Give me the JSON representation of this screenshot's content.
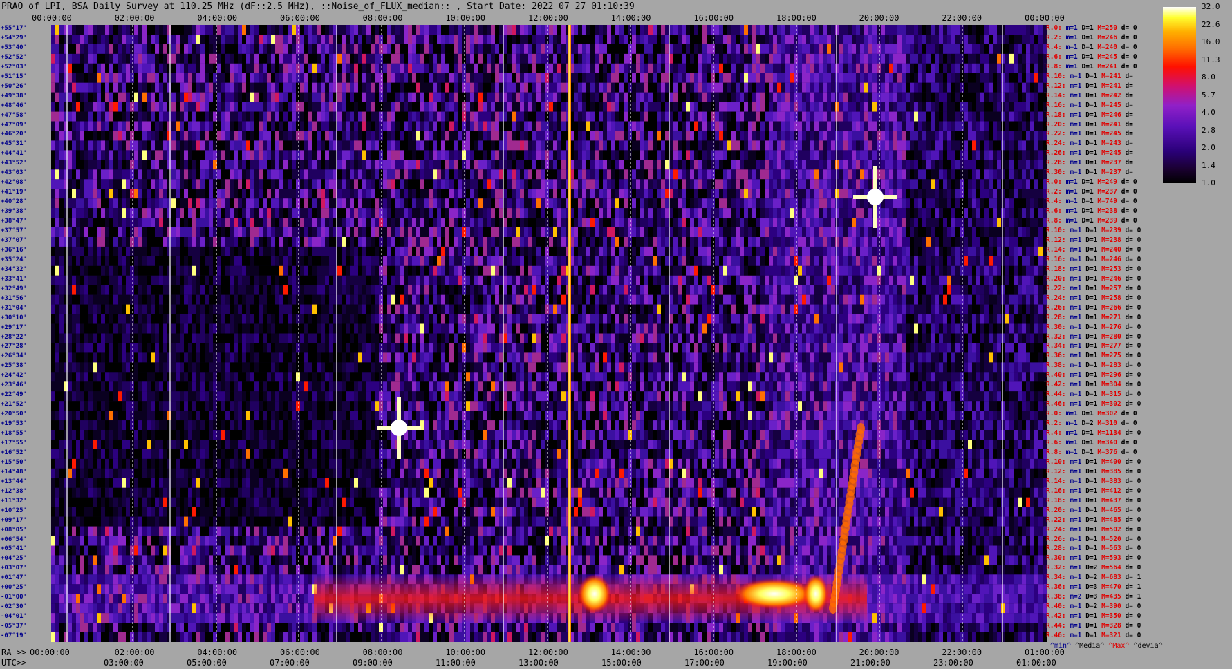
{
  "title": "PRAO of LPI, BSA Daily Survey at 110.25 MHz (dF::2.5 MHz), ::Noise_of_FLUX_median:: , Start Date: 2022 07 27 01:10:39",
  "chart_data": {
    "type": "heatmap",
    "top_axis_labels": [
      "00:00:00",
      "02:00:00",
      "04:00:00",
      "06:00:00",
      "08:00:00",
      "10:00:00",
      "12:00:00",
      "14:00:00",
      "16:00:00",
      "18:00:00",
      "20:00:00",
      "22:00:00",
      "00:00:00"
    ],
    "ra_axis_prefix": "RA >>",
    "ra_axis_labels": [
      "00:00:00",
      "02:00:00",
      "04:00:00",
      "06:00:00",
      "08:00:00",
      "10:00:00",
      "12:00:00",
      "14:00:00",
      "16:00:00",
      "18:00:00",
      "20:00:00",
      "22:00:00",
      "01:00:00"
    ],
    "utc_axis_prefix": "UTC>>",
    "utc_axis_labels": [
      "03:00:00",
      "05:00:00",
      "07:00:00",
      "09:00:00",
      "11:00:00",
      "13:00:00",
      "15:00:00",
      "17:00:00",
      "19:00:00",
      "21:00:00",
      "23:00:00",
      "01:00:00"
    ],
    "declinations": [
      "+55°17'",
      "+54°29'",
      "+53°40'",
      "+52°52'",
      "+52°03'",
      "+51°15'",
      "+50°26'",
      "+49°38'",
      "+48°46'",
      "+47°58'",
      "+47°09'",
      "+46°20'",
      "+45°31'",
      "+44°41'",
      "+43°52'",
      "+43°03'",
      "+42°08'",
      "+41°19'",
      "+40°28'",
      "+39°38'",
      "+38°47'",
      "+37°57'",
      "+37°07'",
      "+36°16'",
      "+35°24'",
      "+34°32'",
      "+33°41'",
      "+32°49'",
      "+31°56'",
      "+31°04'",
      "+30°10'",
      "+29°17'",
      "+28°22'",
      "+27°28'",
      "+26°34'",
      "+25°38'",
      "+24°42'",
      "+23°46'",
      "+22°49'",
      "+21°52'",
      "+20°50'",
      "+19°53'",
      "+18°55'",
      "+17°55'",
      "+16°52'",
      "+15°50'",
      "+14°48'",
      "+13°44'",
      "+12°38'",
      "+11°32'",
      "+10°25'",
      "+09°17'",
      "+08°05'",
      "+06°54'",
      "+05°41'",
      "+04°25'",
      "+03°07'",
      "+01°47'",
      "+00°25'",
      "-01°00'",
      "-02°30'",
      "-04°01'",
      "-05°37'",
      "-07°19'"
    ],
    "row_stats": [
      {
        "r": "R.0:",
        "m": "m=1",
        "d": "D=1",
        "mx": "M=250",
        "dv": "d= 0"
      },
      {
        "r": "R.2:",
        "m": "m=1",
        "d": "D=1",
        "mx": "M=246",
        "dv": "d= 0"
      },
      {
        "r": "R.4:",
        "m": "m=1",
        "d": "D=1",
        "mx": "M=240",
        "dv": "d= 0"
      },
      {
        "r": "R.6:",
        "m": "m=1",
        "d": "D=1",
        "mx": "M=245",
        "dv": "d= 0"
      },
      {
        "r": "R.8:",
        "m": "m=1",
        "d": "D=1",
        "mx": "M=241",
        "dv": "d= 0"
      },
      {
        "r": "R.10:",
        "m": "m=1",
        "d": "D=1",
        "mx": "M=241",
        "dv": "d="
      },
      {
        "r": "R.12:",
        "m": "m=1",
        "d": "D=1",
        "mx": "M=241",
        "dv": "d="
      },
      {
        "r": "R.14:",
        "m": "m=1",
        "d": "D=1",
        "mx": "M=242",
        "dv": "d="
      },
      {
        "r": "R.16:",
        "m": "m=1",
        "d": "D=1",
        "mx": "M=245",
        "dv": "d="
      },
      {
        "r": "R.18:",
        "m": "m=1",
        "d": "D=1",
        "mx": "M=246",
        "dv": "d="
      },
      {
        "r": "R.20:",
        "m": "m=1",
        "d": "D=1",
        "mx": "M=241",
        "dv": "d="
      },
      {
        "r": "R.22:",
        "m": "m=1",
        "d": "D=1",
        "mx": "M=245",
        "dv": "d="
      },
      {
        "r": "R.24:",
        "m": "m=1",
        "d": "D=1",
        "mx": "M=243",
        "dv": "d="
      },
      {
        "r": "R.26:",
        "m": "m=1",
        "d": "D=1",
        "mx": "M=245",
        "dv": "d="
      },
      {
        "r": "R.28:",
        "m": "m=1",
        "d": "D=1",
        "mx": "M=237",
        "dv": "d="
      },
      {
        "r": "R.30:",
        "m": "m=1",
        "d": "D=1",
        "mx": "M=237",
        "dv": "d="
      },
      {
        "r": "R.0:",
        "m": "m=1",
        "d": "D=1",
        "mx": "M=249",
        "dv": "d= 0"
      },
      {
        "r": "R.2:",
        "m": "m=1",
        "d": "D=1",
        "mx": "M=237",
        "dv": "d= 0"
      },
      {
        "r": "R.4:",
        "m": "m=1",
        "d": "D=1",
        "mx": "M=749",
        "dv": "d= 0"
      },
      {
        "r": "R.6:",
        "m": "m=1",
        "d": "D=1",
        "mx": "M=238",
        "dv": "d= 0"
      },
      {
        "r": "R.8:",
        "m": "m=1",
        "d": "D=1",
        "mx": "M=239",
        "dv": "d= 0"
      },
      {
        "r": "R.10:",
        "m": "m=1",
        "d": "D=1",
        "mx": "M=239",
        "dv": "d= 0"
      },
      {
        "r": "R.12:",
        "m": "m=1",
        "d": "D=1",
        "mx": "M=238",
        "dv": "d= 0"
      },
      {
        "r": "R.14:",
        "m": "m=1",
        "d": "D=1",
        "mx": "M=240",
        "dv": "d= 0"
      },
      {
        "r": "R.16:",
        "m": "m=1",
        "d": "D=1",
        "mx": "M=246",
        "dv": "d= 0"
      },
      {
        "r": "R.18:",
        "m": "m=1",
        "d": "D=1",
        "mx": "M=253",
        "dv": "d= 0"
      },
      {
        "r": "R.20:",
        "m": "m=1",
        "d": "D=1",
        "mx": "M=246",
        "dv": "d= 0"
      },
      {
        "r": "R.22:",
        "m": "m=1",
        "d": "D=1",
        "mx": "M=257",
        "dv": "d= 0"
      },
      {
        "r": "R.24:",
        "m": "m=1",
        "d": "D=1",
        "mx": "M=258",
        "dv": "d= 0"
      },
      {
        "r": "R.26:",
        "m": "m=1",
        "d": "D=1",
        "mx": "M=266",
        "dv": "d= 0"
      },
      {
        "r": "R.28:",
        "m": "m=1",
        "d": "D=1",
        "mx": "M=271",
        "dv": "d= 0"
      },
      {
        "r": "R.30:",
        "m": "m=1",
        "d": "D=1",
        "mx": "M=276",
        "dv": "d= 0"
      },
      {
        "r": "R.32:",
        "m": "m=1",
        "d": "D=1",
        "mx": "M=280",
        "dv": "d= 0"
      },
      {
        "r": "R.34:",
        "m": "m=1",
        "d": "D=1",
        "mx": "M=277",
        "dv": "d= 0"
      },
      {
        "r": "R.36:",
        "m": "m=1",
        "d": "D=1",
        "mx": "M=275",
        "dv": "d= 0"
      },
      {
        "r": "R.38:",
        "m": "m=1",
        "d": "D=1",
        "mx": "M=283",
        "dv": "d= 0"
      },
      {
        "r": "R.40:",
        "m": "m=1",
        "d": "D=1",
        "mx": "M=296",
        "dv": "d= 0"
      },
      {
        "r": "R.42:",
        "m": "m=1",
        "d": "D=1",
        "mx": "M=304",
        "dv": "d= 0"
      },
      {
        "r": "R.44:",
        "m": "m=1",
        "d": "D=1",
        "mx": "M=315",
        "dv": "d= 0"
      },
      {
        "r": "R.46:",
        "m": "m=1",
        "d": "D=1",
        "mx": "M=302",
        "dv": "d= 0"
      },
      {
        "r": "R.0:",
        "m": "m=1",
        "d": "D=1",
        "mx": "M=302",
        "dv": "d= 0"
      },
      {
        "r": "R.2:",
        "m": "m=1",
        "d": "D=2",
        "mx": "M=310",
        "dv": "d= 0"
      },
      {
        "r": "R.4:",
        "m": "m=1",
        "d": "D=1",
        "mx": "M=1134",
        "dv": "d= 0"
      },
      {
        "r": "R.6:",
        "m": "m=1",
        "d": "D=1",
        "mx": "M=340",
        "dv": "d= 0"
      },
      {
        "r": "R.8:",
        "m": "m=1",
        "d": "D=1",
        "mx": "M=376",
        "dv": "d= 0"
      },
      {
        "r": "R.10:",
        "m": "m=1",
        "d": "D=1",
        "mx": "M=400",
        "dv": "d= 0"
      },
      {
        "r": "R.12:",
        "m": "m=1",
        "d": "D=1",
        "mx": "M=385",
        "dv": "d= 0"
      },
      {
        "r": "R.14:",
        "m": "m=1",
        "d": "D=1",
        "mx": "M=383",
        "dv": "d= 0"
      },
      {
        "r": "R.16:",
        "m": "m=1",
        "d": "D=1",
        "mx": "M=412",
        "dv": "d= 0"
      },
      {
        "r": "R.18:",
        "m": "m=1",
        "d": "D=1",
        "mx": "M=437",
        "dv": "d= 0"
      },
      {
        "r": "R.20:",
        "m": "m=1",
        "d": "D=1",
        "mx": "M=465",
        "dv": "d= 0"
      },
      {
        "r": "R.22:",
        "m": "m=1",
        "d": "D=1",
        "mx": "M=485",
        "dv": "d= 0"
      },
      {
        "r": "R.24:",
        "m": "m=1",
        "d": "D=1",
        "mx": "M=502",
        "dv": "d= 0"
      },
      {
        "r": "R.26:",
        "m": "m=1",
        "d": "D=1",
        "mx": "M=520",
        "dv": "d= 0"
      },
      {
        "r": "R.28:",
        "m": "m=1",
        "d": "D=1",
        "mx": "M=563",
        "dv": "d= 0"
      },
      {
        "r": "R.30:",
        "m": "m=1",
        "d": "D=1",
        "mx": "M=593",
        "dv": "d= 0"
      },
      {
        "r": "R.32:",
        "m": "m=1",
        "d": "D=2",
        "mx": "M=564",
        "dv": "d= 0"
      },
      {
        "r": "R.34:",
        "m": "m=1",
        "d": "D=2",
        "mx": "M=683",
        "dv": "d= 1"
      },
      {
        "r": "R.36:",
        "m": "m=1",
        "d": "D=3",
        "mx": "M=470",
        "dv": "d= 1"
      },
      {
        "r": "R.38:",
        "m": "m=2",
        "d": "D=3",
        "mx": "M=435",
        "dv": "d= 1"
      },
      {
        "r": "R.40:",
        "m": "m=1",
        "d": "D=2",
        "mx": "M=390",
        "dv": "d= 0"
      },
      {
        "r": "R.42:",
        "m": "m=1",
        "d": "D=1",
        "mx": "M=350",
        "dv": "d= 0"
      },
      {
        "r": "R.44:",
        "m": "m=1",
        "d": "D=1",
        "mx": "M=328",
        "dv": "d= 0"
      },
      {
        "r": "R.46:",
        "m": "m=1",
        "d": "D=1",
        "mx": "M=321",
        "dv": "d= 0"
      }
    ],
    "colorbar": {
      "ticks": [
        "32.0",
        "22.6",
        "16.0",
        "11.3",
        "8.0",
        "5.7",
        "4.0",
        "2.8",
        "2.0",
        "1.4",
        "1.0"
      ],
      "scale": "log",
      "range": [
        1.0,
        32.0
      ]
    },
    "legend": {
      "min": "^min^",
      "media": "^Media^",
      "max": "^Max^",
      "devia": "^devia^"
    },
    "colors": {
      "background": "#a6a6a6",
      "stat_red": "#e00000",
      "stat_blue": "#00008b"
    }
  }
}
